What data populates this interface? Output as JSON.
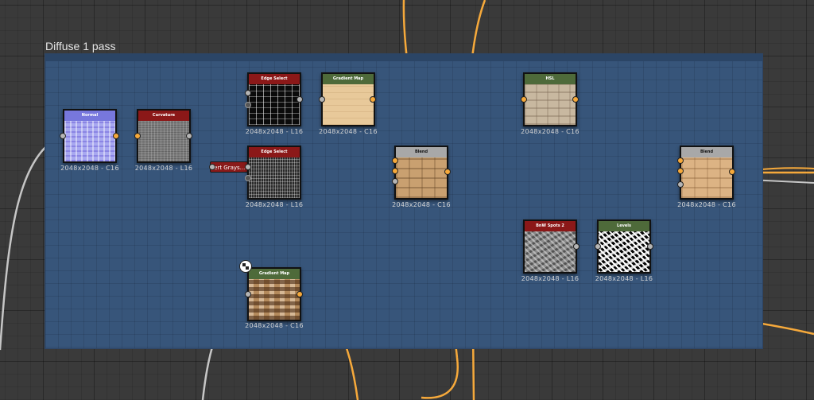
{
  "frame": {
    "title": "Diffuse 1 pass",
    "color": "#37557a"
  },
  "colors": {
    "wire_gray": "#c6c6c6",
    "wire_orange": "#f6a93b",
    "header_red": "#8b1818",
    "header_green": "#4e6a3a",
    "header_purple": "#7777dd",
    "header_gray": "#a8a8a8"
  },
  "nodes": {
    "normal": {
      "title": "Normal",
      "res": "2048x2048 - C16"
    },
    "curvature": {
      "title": "Curvature",
      "res": "2048x2048 - L16"
    },
    "edge_select_1": {
      "title": "Edge Select",
      "res": ""
    },
    "edge_select_2": {
      "title": "Edge Select",
      "res": "2048x2048 - L16"
    },
    "gradient_map_1": {
      "title": "Gradient Map",
      "res": "2048x2048 - C16"
    },
    "gradient_map_2": {
      "title": "Gradient Map",
      "res": "2048x2048 - C16"
    },
    "blend_1": {
      "title": "Blend",
      "res": "2048x2048 - C16"
    },
    "hsl": {
      "title": "HSL",
      "res": "2048x2048 - C16"
    },
    "bw_spots": {
      "title": "BnW Spots 2",
      "res": "2048x2048 - L16"
    },
    "levels": {
      "title": "Levels",
      "res": "2048x2048 - L16"
    },
    "blend_2": {
      "title": "Blend",
      "res": "2048x2048 - C16"
    }
  },
  "extra_labels": {
    "edge_select_1_res": "2048x2048 - L16"
  },
  "invert_node": {
    "label": "vert Grays..."
  }
}
